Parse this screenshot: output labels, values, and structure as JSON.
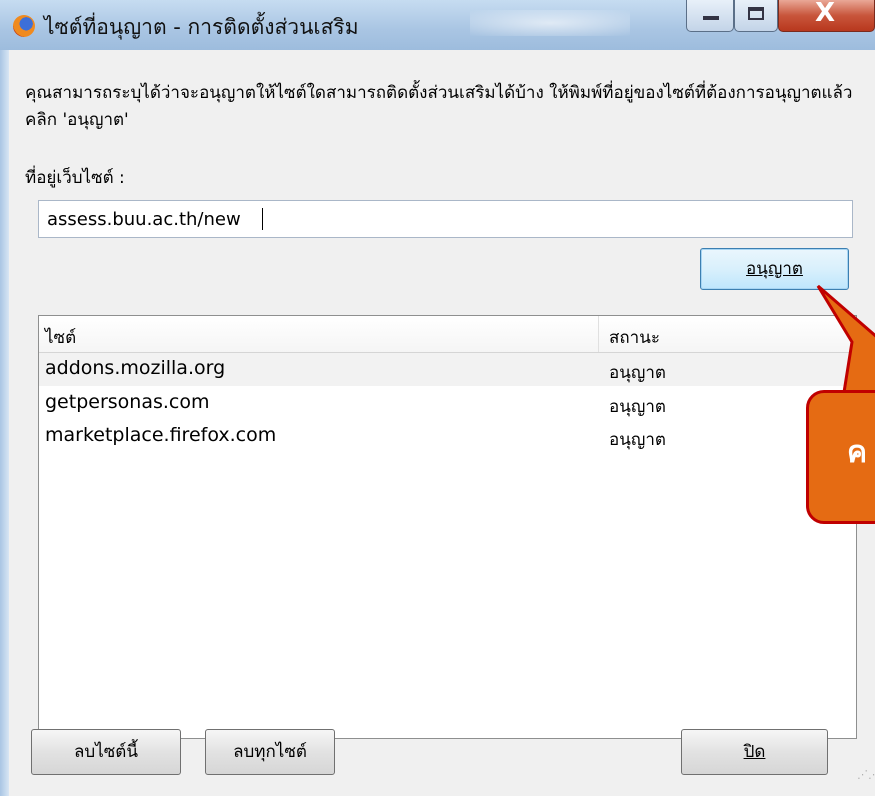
{
  "window": {
    "title": "ไซต์ที่อนุญาต - การติดตั้งส่วนเสริม",
    "close_glyph": "X"
  },
  "description": "คุณสามารถระบุได้ว่าจะอนุญาตให้ไซต์ใดสามารถติดตั้งส่วนเสริมได้บ้าง ให้พิมพ์ที่อยู่ของไซต์ที่ต้องการอนุญาตแล้วคลิก 'อนุญาต'",
  "address": {
    "label": "ที่อยู่เว็บไซต์ :",
    "value": "assess.buu.ac.th/new"
  },
  "buttons": {
    "allow": "อนุญาต",
    "remove_site": "ลบไซต์นี้",
    "remove_all": "ลบทุกไซต์",
    "close": "ปิด"
  },
  "list": {
    "columns": [
      "ไซต์",
      "สถานะ"
    ],
    "rows": [
      {
        "site": "addons.mozilla.org",
        "status": "อนุญาต"
      },
      {
        "site": "getpersonas.com",
        "status": "อนุญาต"
      },
      {
        "site": "marketplace.firefox.com",
        "status": "อนุญาต"
      }
    ]
  },
  "callout": {
    "text": "ค",
    "fill_color": "#e56b13",
    "border_color": "#c00000"
  }
}
